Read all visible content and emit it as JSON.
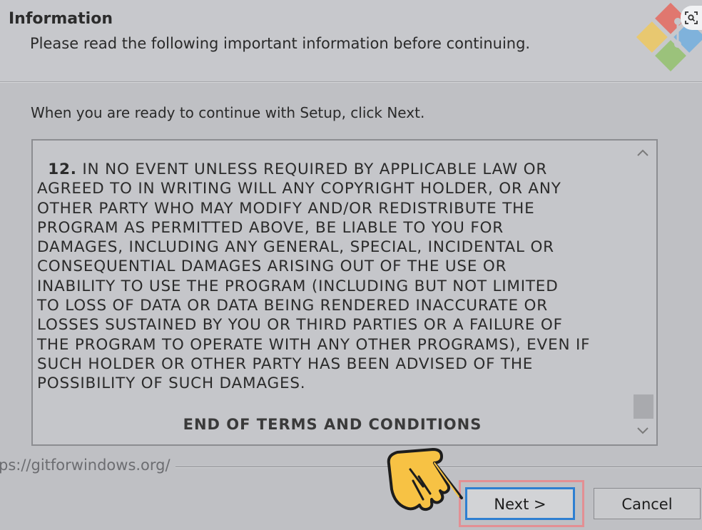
{
  "header": {
    "title": "Information",
    "subtitle": "Please read the following important information before continuing."
  },
  "instruction": "When you are ready to continue with Setup, click Next.",
  "license": {
    "section_number": "12.",
    "line_1": " IN NO EVENT UNLESS REQUIRED BY APPLICABLE LAW OR",
    "lines": [
      "AGREED TO IN WRITING WILL ANY COPYRIGHT HOLDER, OR ANY",
      "OTHER PARTY WHO MAY MODIFY AND/OR REDISTRIBUTE THE",
      "PROGRAM AS PERMITTED ABOVE, BE LIABLE TO YOU FOR",
      "DAMAGES, INCLUDING ANY GENERAL, SPECIAL, INCIDENTAL OR",
      "CONSEQUENTIAL DAMAGES ARISING OUT OF THE USE OR",
      "INABILITY TO USE THE PROGRAM (INCLUDING BUT NOT LIMITED",
      "TO LOSS OF DATA OR DATA BEING RENDERED INACCURATE OR",
      "LOSSES SUSTAINED BY YOU OR THIRD PARTIES OR A FAILURE OF",
      "THE PROGRAM TO OPERATE WITH ANY OTHER PROGRAMS), EVEN IF",
      "SUCH HOLDER OR OTHER PARTY HAS BEEN ADVISED OF THE",
      "POSSIBILITY OF SUCH DAMAGES."
    ],
    "end_text": "END OF TERMS AND CONDITIONS"
  },
  "footer": {
    "url": "ps://gitforwindows.org/"
  },
  "buttons": {
    "next": "Next >",
    "cancel": "Cancel"
  },
  "colors": {
    "focus_border": "#2e7fd1",
    "highlight_box": "#e38f93",
    "hand_fill": "#f7c244"
  },
  "icons": {
    "logo": "git-for-windows-logo",
    "lens": "screen-search-icon",
    "pointer": "pointing-hand-icon"
  }
}
